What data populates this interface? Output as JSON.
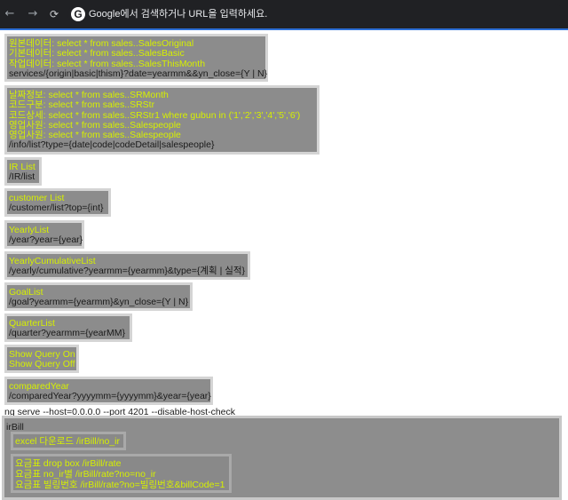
{
  "browser": {
    "back_icon": "arrow-left",
    "forward_icon": "arrow-right",
    "reload_icon": "reload",
    "logo": "G",
    "address_placeholder": "Google에서 검색하거나 URL을 입력하세요."
  },
  "blocks": {
    "b1": {
      "l1": "원본데이터: select * from sales..SalesOriginal",
      "l2": "기본데이터: select * from sales..SalesBasic",
      "l3": "작업데이터: select * from sales..SalesThisMonth",
      "l4": "services/{origin|basic|thism}?date=yearmm&&yn_close={Y | N}"
    },
    "b2": {
      "l1": "날짜정보: select * from sales..SRMonth",
      "l2": "코드구분: select * from sales..SRStr",
      "l3": "코드상세: select * from sales..SRStr1 where gubun in ('1','2','3','4','5','6')",
      "l4": "영업사원: select * from sales..Salespeople",
      "l5": "영업사원: select * from sales..Salespeople",
      "l6": "/info/list?type={date|code|codeDetail|salespeople}"
    },
    "b3": {
      "l1": "IR List",
      "l2": "/IR/list"
    },
    "b4": {
      "l1": "customer List",
      "l2": "/customer/list?top={int}"
    },
    "b5": {
      "l1": "YearlyList",
      "l2": "/year?year={year}"
    },
    "b6": {
      "l1": "YearlyCumulativeList",
      "l2": "/yearly/cumulative?yearmm={yearmm}&type={계획 | 실적}"
    },
    "b7": {
      "l1": "GoalList",
      "l2": "/goal?yearmm={yearmm}&yn_close={Y | N}"
    },
    "b8": {
      "l1": "QuarterList",
      "l2": "/quarter?yearmm={yearMM}"
    },
    "b9": {
      "l1": "Show Query On",
      "l2": "Show Query Off"
    },
    "b10": {
      "l1": "comparedYear",
      "l2": "/comparedYear?yyyymm={yyyymm}&year={year}"
    },
    "serve_cmd": "ng serve --host=0.0.0.0 --port 4201 --disable-host-check",
    "b11": {
      "title": "irBill",
      "excel": "excel 다운로드 /irBill/no_ir",
      "r1": "요금표 drop box /irBill/rate",
      "r2": "요금표 no_ir별 /irBill/rate?no=no_ir",
      "r3": "요금표 빌링번호 /irBill/rate?no=빌링번호&billCode=1"
    }
  }
}
